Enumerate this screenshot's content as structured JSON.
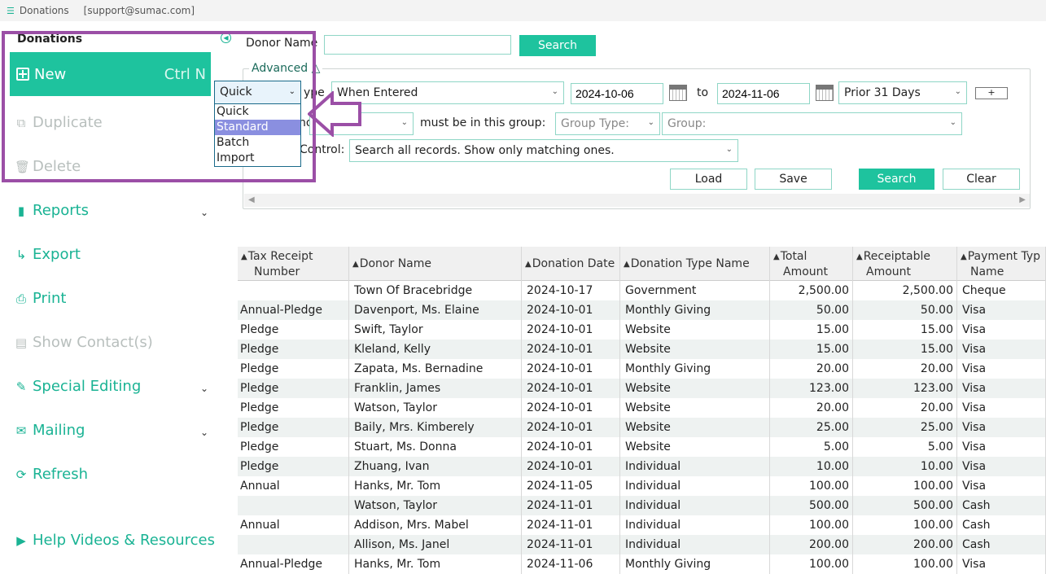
{
  "titlebar": {
    "app": "Donations",
    "account": "[support@sumac.com]"
  },
  "sidebar": {
    "title": "Donations",
    "new_label": "New",
    "new_shortcut": "Ctrl N",
    "duplicate_label": "Duplicate",
    "delete_label": "Delete",
    "reports_label": "Reports",
    "export_label": "Export",
    "print_label": "Print",
    "show_contacts_label": "Show Contact(s)",
    "special_editing_label": "Special Editing",
    "mailing_label": "Mailing",
    "refresh_label": "Refresh",
    "help_label": "Help Videos & Resources"
  },
  "search": {
    "donor_name_label": "Donor Name",
    "donor_name_value": "",
    "search_button": "Search",
    "advanced_label": "Advanced △",
    "type_label_partial": "ype",
    "type_value": "When Entered",
    "date_from": "2024-10-06",
    "to_label": "to",
    "date_to": "2024-11-06",
    "period_value": "Prior 31 Days",
    "plus_button": "+",
    "who_label_partial": "no",
    "group_label": "must be in this group:",
    "group_type_placeholder": "Group Type:",
    "group_placeholder": "Group:",
    "control_label_partial": "Control:",
    "control_value": "Search all records. Show only matching ones.",
    "load_button": "Load",
    "save_button": "Save",
    "search_button2": "Search",
    "clear_button": "Clear"
  },
  "mode_dropdown": {
    "selected": "Quick",
    "options": [
      "Quick",
      "Standard",
      "Batch",
      "Import"
    ],
    "highlighted": "Standard"
  },
  "table": {
    "headers": [
      "Tax Receipt Number",
      "Donor Name",
      "Donation Date",
      "Donation Type Name",
      "Total Amount",
      "Receiptable Amount",
      "Payment Type Name"
    ],
    "header_lines": [
      [
        "Tax Receipt",
        "Number"
      ],
      [
        "Donor Name",
        ""
      ],
      [
        "Donation Date",
        ""
      ],
      [
        "Donation Type Name",
        ""
      ],
      [
        "Total",
        "Amount"
      ],
      [
        "Receiptable",
        "Amount"
      ],
      [
        "Payment Typ",
        "Name"
      ]
    ],
    "rows": [
      [
        "",
        "Town Of Bracebridge",
        "2024-10-17",
        "Government",
        "2,500.00",
        "2,500.00",
        "Cheque"
      ],
      [
        "Annual-Pledge",
        "Davenport, Ms. Elaine",
        "2024-10-01",
        "Monthly Giving",
        "50.00",
        "50.00",
        "Visa"
      ],
      [
        "Pledge",
        "Swift, Taylor",
        "2024-10-01",
        "Website",
        "15.00",
        "15.00",
        "Visa"
      ],
      [
        "Pledge",
        "Kleland, Kelly",
        "2024-10-01",
        "Website",
        "15.00",
        "15.00",
        "Visa"
      ],
      [
        "Pledge",
        "Zapata, Ms. Bernadine",
        "2024-10-01",
        "Monthly Giving",
        "20.00",
        "20.00",
        "Visa"
      ],
      [
        "Pledge",
        "Franklin, James",
        "2024-10-01",
        "Website",
        "123.00",
        "123.00",
        "Visa"
      ],
      [
        "Pledge",
        "Watson, Taylor",
        "2024-10-01",
        "Website",
        "20.00",
        "20.00",
        "Visa"
      ],
      [
        "Pledge",
        "Baily, Mrs. Kimberely",
        "2024-10-01",
        "Website",
        "25.00",
        "25.00",
        "Visa"
      ],
      [
        "Pledge",
        "Stuart, Ms. Donna",
        "2024-10-01",
        "Website",
        "5.00",
        "5.00",
        "Visa"
      ],
      [
        "Pledge",
        "Zhuang, Ivan",
        "2024-10-01",
        "Individual",
        "10.00",
        "10.00",
        "Visa"
      ],
      [
        "Annual",
        "Hanks, Mr. Tom",
        "2024-11-05",
        "Individual",
        "100.00",
        "100.00",
        "Visa"
      ],
      [
        "",
        "Watson, Taylor",
        "2024-11-01",
        "Individual",
        "500.00",
        "500.00",
        "Cash"
      ],
      [
        "Annual",
        "Addison, Mrs. Mabel",
        "2024-11-01",
        "Individual",
        "100.00",
        "100.00",
        "Cash"
      ],
      [
        "",
        "Allison, Ms. Janel",
        "2024-11-01",
        "Individual",
        "200.00",
        "200.00",
        "Cash"
      ],
      [
        "Annual-Pledge",
        "Hanks, Mr. Tom",
        "2024-11-06",
        "Monthly Giving",
        "100.00",
        "100.00",
        "Visa"
      ]
    ]
  },
  "colors": {
    "accent": "#1ec39e",
    "highlight_box": "#9b4fa6",
    "selection": "#8a8fe0"
  }
}
